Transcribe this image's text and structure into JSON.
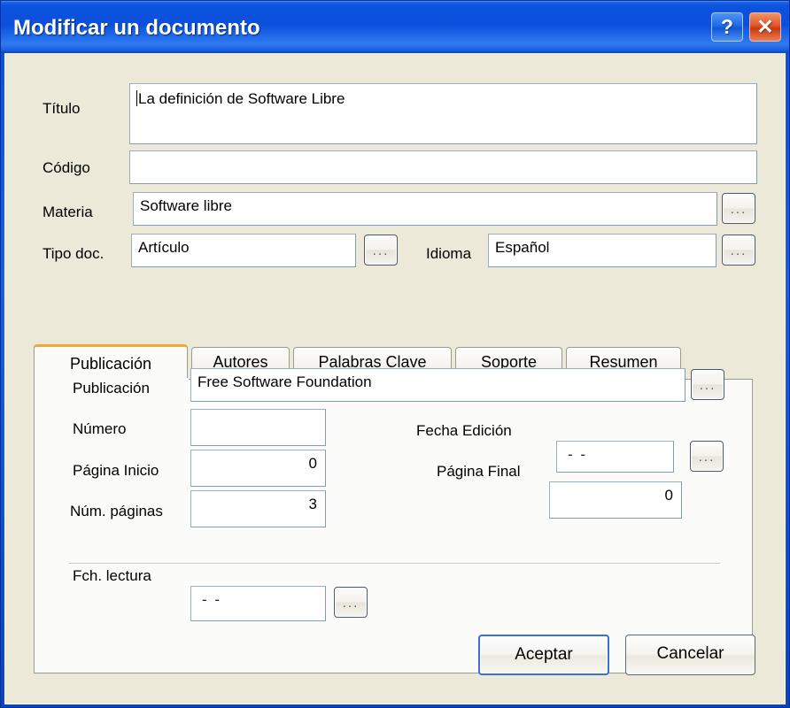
{
  "window": {
    "title": "Modificar un documento",
    "help_label": "?",
    "close_label": "✕",
    "accent_titlebar": "#0b4fdc",
    "accent_body": "#ece9d8",
    "accent_tab_active": "#f0a830"
  },
  "form": {
    "titulo": {
      "label": "Título",
      "value": "La definición de Software Libre"
    },
    "codigo": {
      "label": "Código",
      "value": ""
    },
    "materia": {
      "label": "Materia",
      "value": "Software libre",
      "browse_label": "..."
    },
    "tipo_doc": {
      "label": "Tipo doc.",
      "value": "Artículo",
      "browse_label": "..."
    },
    "idioma": {
      "label": "Idioma",
      "value": "Español",
      "browse_label": "..."
    }
  },
  "tabs": [
    {
      "label": "Publicación",
      "active": true
    },
    {
      "label": "Autores",
      "active": false
    },
    {
      "label": "Palabras Clave",
      "active": false
    },
    {
      "label": "Soporte",
      "active": false
    },
    {
      "label": "Resumen",
      "active": false
    }
  ],
  "publicacion_tab": {
    "publicacion": {
      "label": "Publicación",
      "value": "Free Software Foundation",
      "browse_label": "..."
    },
    "numero": {
      "label": "Número",
      "value": ""
    },
    "fecha_edicion": {
      "label": "Fecha Edición",
      "value": "-  -",
      "browse_label": "..."
    },
    "pagina_inicio": {
      "label": "Página Inicio",
      "value": "0"
    },
    "pagina_final": {
      "label": "Página Final",
      "value": "0"
    },
    "num_paginas": {
      "label": "Núm. páginas",
      "value": "3"
    },
    "fch_lectura": {
      "label": "Fch. lectura",
      "value": "-  -",
      "browse_label": "..."
    }
  },
  "footer": {
    "accept_label": "Aceptar",
    "cancel_label": "Cancelar"
  }
}
